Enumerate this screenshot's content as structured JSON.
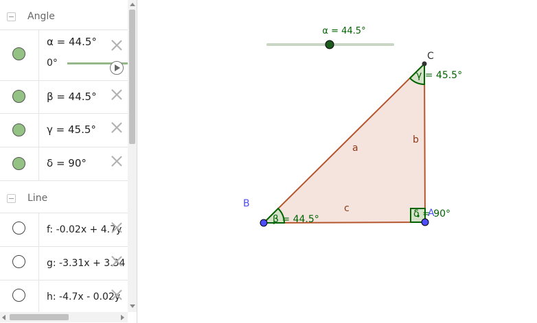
{
  "algebra": {
    "groups": [
      {
        "label": "Angle",
        "rows": [
          {
            "text": "α = 44.5°",
            "slider_min": "0°",
            "visible": true
          },
          {
            "text": "β = 44.5°",
            "visible": true
          },
          {
            "text": "γ = 45.5°",
            "visible": true
          },
          {
            "text": "δ = 90°",
            "visible": true
          }
        ]
      },
      {
        "label": "Line",
        "rows": [
          {
            "text": "f: -0.02x + 4.7y",
            "visible": false
          },
          {
            "text": "g: -3.31x + 3.34",
            "visible": false
          },
          {
            "text": "h: -4.7x - 0.02y",
            "visible": false
          }
        ]
      }
    ]
  },
  "graphics": {
    "slider": {
      "label": "α = 44.5°",
      "value": 44.5
    },
    "points": {
      "A": {
        "label": "A",
        "color": "#4d4dff"
      },
      "B": {
        "label": "B",
        "color": "#4d4dff"
      },
      "C": {
        "label": "C",
        "color": "#333333"
      }
    },
    "segments": {
      "a": "a",
      "b": "b",
      "c": "c"
    },
    "angle_labels": {
      "beta": "β = 44.5°",
      "gamma": "γ = 45.5°",
      "delta": "δ = 90°"
    },
    "colors": {
      "triangle_stroke": "#b5562f",
      "triangle_fill": "#f5e3dd",
      "angle": "#006400",
      "angle_fill": "#c8e0c0",
      "segment_label": "#8b3a1a",
      "slider_track": "#c8d6c3",
      "slider_handle": "#1e5a1e"
    }
  }
}
